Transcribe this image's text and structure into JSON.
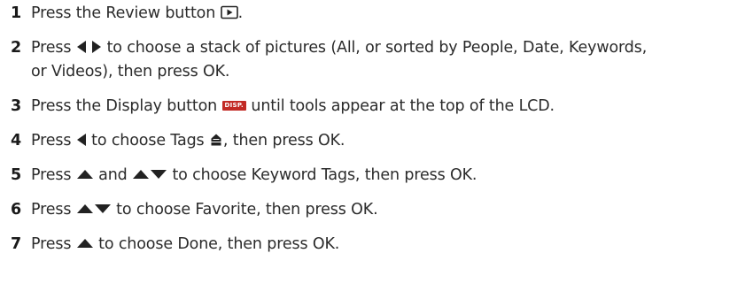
{
  "steps": [
    {
      "number": "1",
      "parts": [
        "Press the Review button ",
        "."
      ]
    },
    {
      "number": "2",
      "parts": [
        "Press ",
        " ",
        " to choose a stack of pictures (All, or sorted by People, Date, Keywords,",
        "or Videos), then press OK."
      ]
    },
    {
      "number": "3",
      "parts": [
        "Press the Display button ",
        " until tools appear at the top of the LCD."
      ],
      "disp_label": "DISP."
    },
    {
      "number": "4",
      "parts": [
        "Press ",
        " to choose Tags ",
        ", then press OK."
      ]
    },
    {
      "number": "5",
      "parts": [
        "Press ",
        " and ",
        " to choose Keyword Tags, then press OK."
      ]
    },
    {
      "number": "6",
      "parts": [
        "Press ",
        " to choose Favorite, then press OK."
      ]
    },
    {
      "number": "7",
      "parts": [
        "Press ",
        " to choose Done, then press OK."
      ]
    }
  ],
  "icons": {
    "review": "review-button-icon",
    "left": "left-arrow-icon",
    "right": "right-arrow-icon",
    "up": "up-arrow-icon",
    "down": "down-arrow-icon",
    "tags": "tags-icon",
    "display": "display-button-icon"
  }
}
